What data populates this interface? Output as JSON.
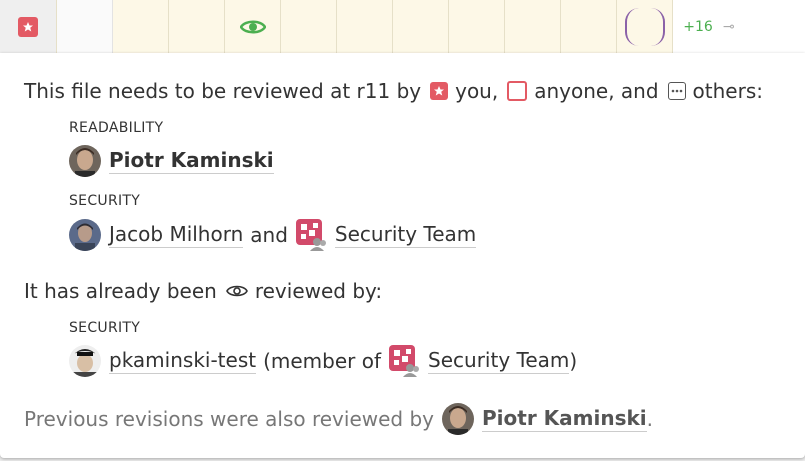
{
  "toprow": {
    "count_label": "+16",
    "end_glyph": "⊸"
  },
  "summary": {
    "prefix": "This file needs to be reviewed at r11 by",
    "you": "you,",
    "anyone": "anyone, and",
    "others": "others:"
  },
  "needed": [
    {
      "heading": "READABILITY",
      "name": "Piotr Kaminski"
    },
    {
      "heading": "SECURITY",
      "name": "Jacob Milhorn",
      "joiner": "and",
      "team": "Security Team"
    }
  ],
  "reviewed_line": {
    "prefix": "It has already been",
    "suffix": "reviewed by:"
  },
  "reviewed": {
    "heading": "SECURITY",
    "name": "pkaminski-test",
    "member_prefix": "(member of",
    "team": "Security Team",
    "member_suffix": ")"
  },
  "previous": {
    "prefix": "Previous revisions were also reviewed by",
    "name": "Piotr Kaminski",
    "suffix": "."
  },
  "colors": {
    "accent_red": "#e35a64",
    "eye_green": "#4caf50",
    "bracket_purple": "#8b62a8"
  }
}
